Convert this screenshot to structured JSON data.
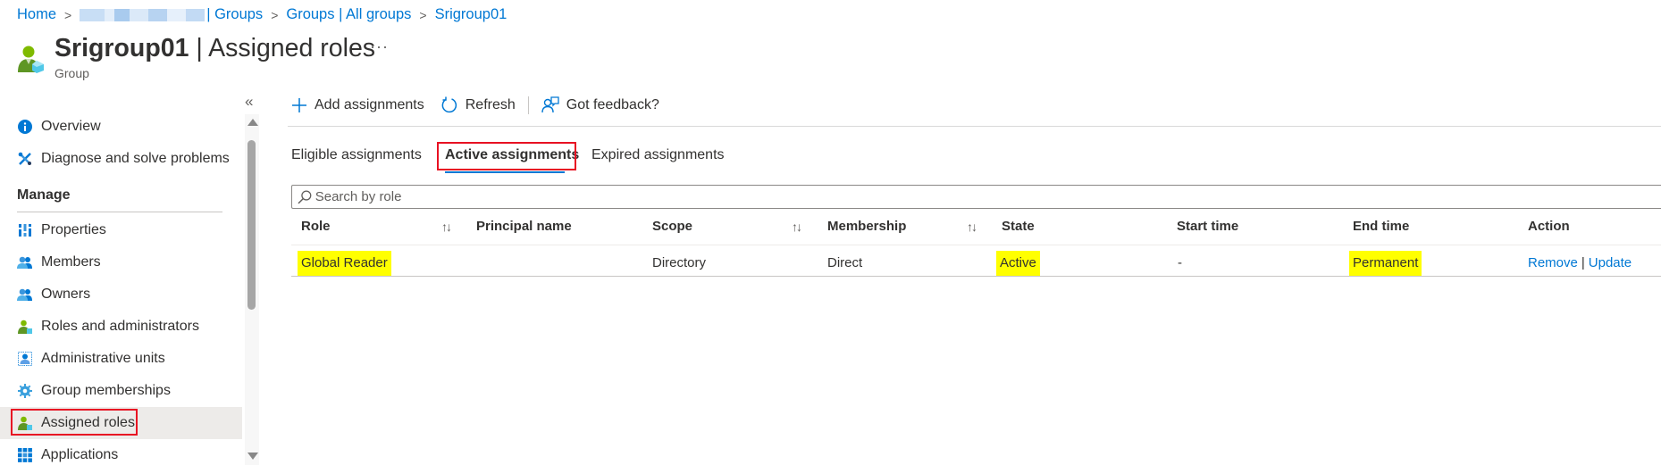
{
  "breadcrumb": {
    "items": [
      "Home",
      "| Groups",
      "Groups | All groups",
      "Srigroup01"
    ],
    "separator": ">"
  },
  "header": {
    "title_bold": "Srigroup01",
    "title_rest": " | Assigned roles",
    "more": "···",
    "subtitle": "Group",
    "icon": "group-role-icon"
  },
  "sidebar": {
    "collapse": "«",
    "items": [
      {
        "label": "Overview",
        "icon": "info-icon"
      },
      {
        "label": "Diagnose and solve problems",
        "icon": "wrench-icon"
      }
    ],
    "section": "Manage",
    "manage_items": [
      {
        "label": "Properties",
        "icon": "properties-icon"
      },
      {
        "label": "Members",
        "icon": "members-icon"
      },
      {
        "label": "Owners",
        "icon": "owners-icon"
      },
      {
        "label": "Roles and administrators",
        "icon": "roles-icon"
      },
      {
        "label": "Administrative units",
        "icon": "admin-units-icon"
      },
      {
        "label": "Group memberships",
        "icon": "gear-icon"
      },
      {
        "label": "Assigned roles",
        "icon": "assigned-roles-icon",
        "selected": true
      },
      {
        "label": "Applications",
        "icon": "applications-icon"
      }
    ]
  },
  "toolbar": {
    "add": "Add assignments",
    "refresh": "Refresh",
    "feedback": "Got feedback?"
  },
  "tabs": [
    {
      "label": "Eligible assignments"
    },
    {
      "label": "Active assignments",
      "active": true
    },
    {
      "label": "Expired assignments"
    }
  ],
  "search": {
    "placeholder": "Search by role",
    "value": ""
  },
  "table": {
    "columns": [
      "Role",
      "Principal name",
      "Scope",
      "Membership",
      "State",
      "Start time",
      "End time",
      "Action"
    ],
    "sort_glyph": "↑↓",
    "rows": [
      {
        "role": "Global Reader",
        "principal": "",
        "scope": "Directory",
        "membership": "Direct",
        "state": "Active",
        "start": "-",
        "end": "Permanent",
        "actions": [
          "Remove",
          "Update"
        ],
        "action_sep": "|"
      }
    ]
  },
  "colors": {
    "accent": "#0078d4",
    "highlight": "#ffff00",
    "annotation": "#e81123"
  }
}
